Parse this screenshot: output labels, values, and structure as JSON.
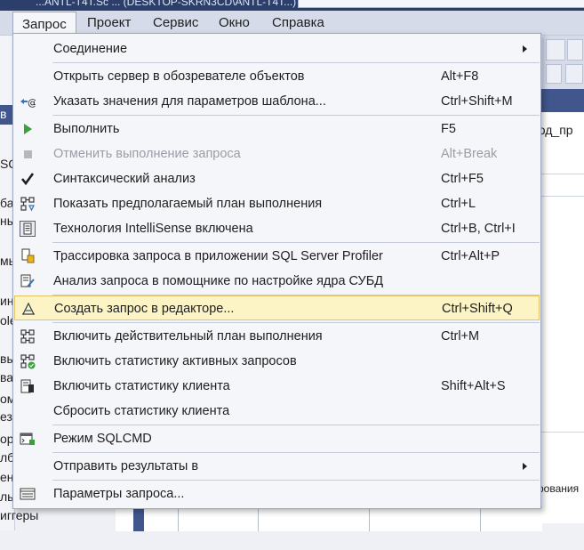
{
  "title_fragment": "...ANTL-T4T.Sc ... (DESKTOP-SKRN3CD\\ANTL-T4T...)",
  "menubar": {
    "items": [
      "Запрос",
      "Проект",
      "Сервис",
      "Окно",
      "Справка"
    ]
  },
  "background": {
    "left_fragments": [
      "в",
      "SQ",
      "ба",
      "ны",
      "мы",
      "ин",
      "ole",
      "вы",
      "ва",
      "ом",
      "езу",
      "ор",
      "лб",
      "ен",
      "ль"
    ],
    "left_bottom_fragment": "иггеры",
    "right_code_fragment": "род_пр",
    "grid_header_fragment": "рования"
  },
  "menu": {
    "items": [
      {
        "label": "Соединение",
        "shortcut": "",
        "icon": "",
        "submenu": true,
        "disabled": false
      },
      {
        "label": "Открыть сервер в обозревателе объектов",
        "shortcut": "Alt+F8",
        "icon": "",
        "submenu": false,
        "disabled": false
      },
      {
        "label": "Указать значения для параметров шаблона...",
        "shortcut": "Ctrl+Shift+M",
        "icon": "template-params-icon",
        "submenu": false,
        "disabled": false
      },
      {
        "label": "Выполнить",
        "shortcut": "F5",
        "icon": "play-icon",
        "submenu": false,
        "disabled": false
      },
      {
        "label": "Отменить выполнение запроса",
        "shortcut": "Alt+Break",
        "icon": "stop-icon",
        "submenu": false,
        "disabled": true
      },
      {
        "label": "Синтаксический анализ",
        "shortcut": "Ctrl+F5",
        "icon": "checkmark-icon",
        "submenu": false,
        "disabled": false
      },
      {
        "label": "Показать предполагаемый план выполнения",
        "shortcut": "Ctrl+L",
        "icon": "estimated-plan-icon",
        "submenu": false,
        "disabled": false
      },
      {
        "label": "Технология IntelliSense включена",
        "shortcut": "Ctrl+B, Ctrl+I",
        "icon": "intellisense-icon",
        "submenu": false,
        "disabled": false
      },
      {
        "label": "Трассировка запроса в приложении SQL Server Profiler",
        "shortcut": "Ctrl+Alt+P",
        "icon": "profiler-icon",
        "submenu": false,
        "disabled": false
      },
      {
        "label": "Анализ запроса в помощнике по настройке ядра СУБД",
        "shortcut": "",
        "icon": "tuning-advisor-icon",
        "submenu": false,
        "disabled": false
      },
      {
        "label": "Создать запрос в редакторе...",
        "shortcut": "Ctrl+Shift+Q",
        "icon": "query-designer-icon",
        "submenu": false,
        "disabled": false,
        "highlighted": true
      },
      {
        "label": "Включить действительный план выполнения",
        "shortcut": "Ctrl+M",
        "icon": "actual-plan-icon",
        "submenu": false,
        "disabled": false
      },
      {
        "label": "Включить статистику активных запросов",
        "shortcut": "",
        "icon": "live-stats-icon",
        "submenu": false,
        "disabled": false
      },
      {
        "label": "Включить статистику клиента",
        "shortcut": "Shift+Alt+S",
        "icon": "client-stats-icon",
        "submenu": false,
        "disabled": false
      },
      {
        "label": "Сбросить статистику клиента",
        "shortcut": "",
        "icon": "",
        "submenu": false,
        "disabled": false
      },
      {
        "label": "Режим SQLCMD",
        "shortcut": "",
        "icon": "sqlcmd-icon",
        "submenu": false,
        "disabled": false
      },
      {
        "label": "Отправить результаты в",
        "shortcut": "",
        "icon": "",
        "submenu": true,
        "disabled": false
      },
      {
        "label": "Параметры запроса...",
        "shortcut": "",
        "icon": "query-options-icon",
        "submenu": false,
        "disabled": false
      }
    ]
  }
}
